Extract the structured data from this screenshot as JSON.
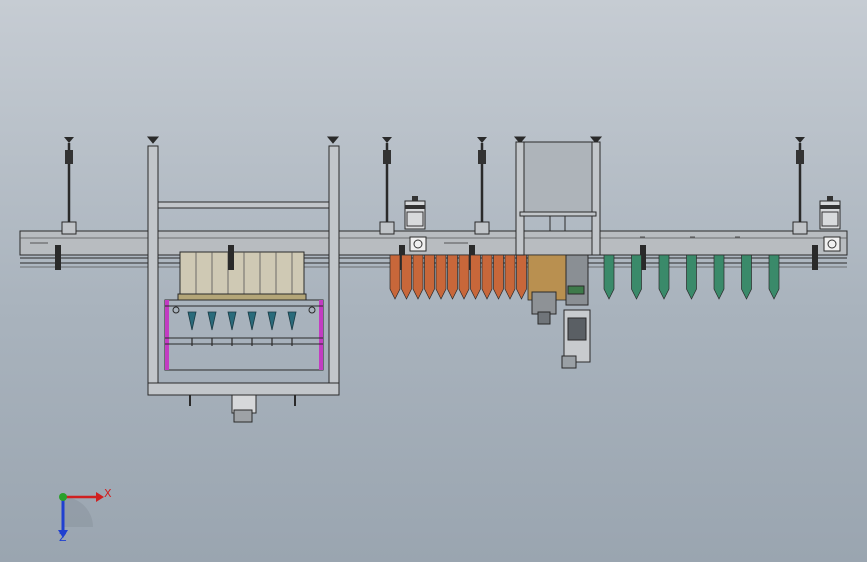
{
  "viewport": {
    "background_top": "#c6ccd3",
    "background_bottom": "#9aa5b0"
  },
  "colors": {
    "frame_line": "#2a2a2a",
    "beam_fill": "#b8bcc0",
    "orange_bottle": "#c8673a",
    "green_bottle": "#3a8a6a",
    "magenta_frame": "#c23cc2",
    "hopper_fill": "#cfc9b4",
    "tray_fill": "#b4a678",
    "axis_x": "#d02020",
    "axis_y": "#2aa02a",
    "axis_z": "#2040d0"
  },
  "triad": {
    "x_label": "X",
    "z_label": "Z"
  },
  "drawing": {
    "icons": [
      "axis-triad-icon",
      "gear-motor-icon",
      "leveling-foot-icon"
    ]
  }
}
